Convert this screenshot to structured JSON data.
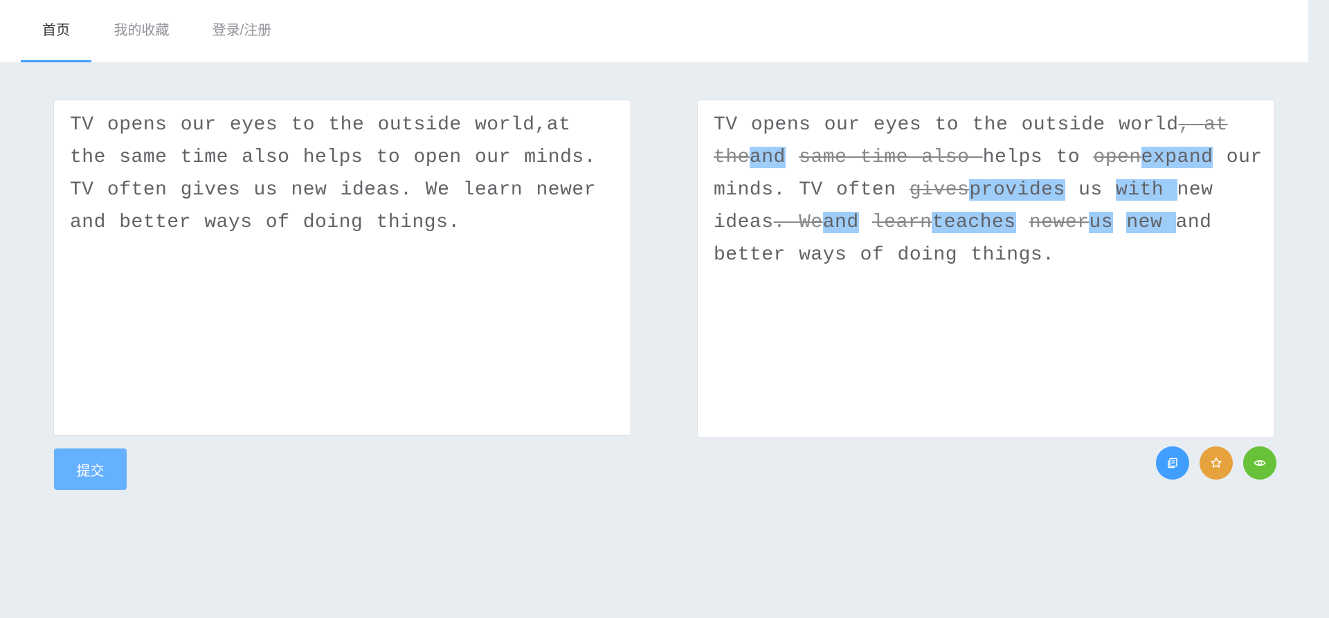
{
  "nav": {
    "tabs": [
      {
        "label": "首页"
      },
      {
        "label": "我的收藏"
      },
      {
        "label": "登录/注册"
      }
    ],
    "active_tab": 0
  },
  "source": {
    "text": "TV opens our eyes to the outside world,at the same time also helps to open our minds. TV often gives us new ideas. We learn newer and better ways of doing things."
  },
  "result": {
    "segments": [
      {
        "type": "same",
        "text": "TV opens our eyes to the outside world"
      },
      {
        "type": "del",
        "text": ", at the"
      },
      {
        "type": "ins",
        "text": "and"
      },
      {
        "type": "same",
        "text": " "
      },
      {
        "type": "del",
        "text": "same time also "
      },
      {
        "type": "same",
        "text": "helps to "
      },
      {
        "type": "del",
        "text": "open"
      },
      {
        "type": "ins",
        "text": "expand"
      },
      {
        "type": "same",
        "text": " our minds. TV often "
      },
      {
        "type": "del",
        "text": "gives"
      },
      {
        "type": "ins",
        "text": "provides"
      },
      {
        "type": "same",
        "text": " us "
      },
      {
        "type": "ins",
        "text": "with "
      },
      {
        "type": "same",
        "text": "new ideas"
      },
      {
        "type": "del",
        "text": ". We"
      },
      {
        "type": "ins",
        "text": "and"
      },
      {
        "type": "same",
        "text": " "
      },
      {
        "type": "del",
        "text": "learn"
      },
      {
        "type": "ins",
        "text": "teaches"
      },
      {
        "type": "same",
        "text": " "
      },
      {
        "type": "del",
        "text": "newer"
      },
      {
        "type": "ins",
        "text": "us"
      },
      {
        "type": "same",
        "text": " "
      },
      {
        "type": "ins",
        "text": "new "
      },
      {
        "type": "same",
        "text": "and better ways of doing things."
      }
    ]
  },
  "actions": {
    "submit_label": "提交",
    "copy_icon": "copy-icon",
    "favorite_icon": "star-icon",
    "preview_icon": "eye-icon"
  },
  "colors": {
    "accent": "#409eff",
    "insert_highlight": "#9fcdfa",
    "favorite": "#e6a23c",
    "preview": "#67c23a",
    "background": "#e8edf2"
  }
}
